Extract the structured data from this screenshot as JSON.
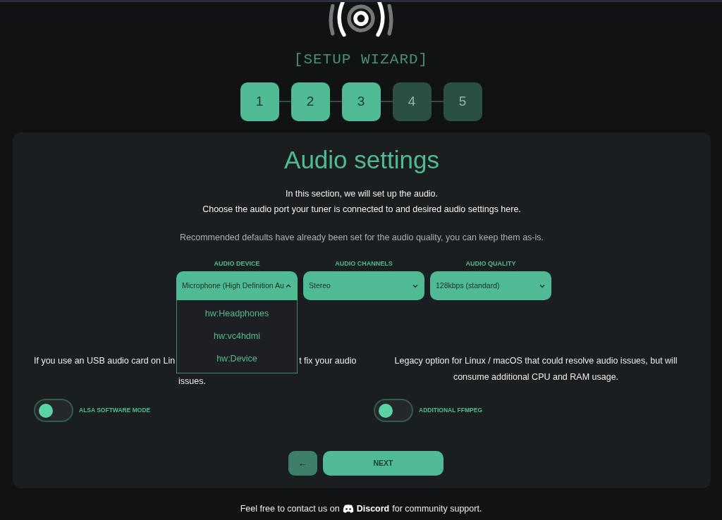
{
  "header": {
    "title": "[SETUP WIZARD]"
  },
  "steps": [
    {
      "label": "1",
      "active": true
    },
    {
      "label": "2",
      "active": true
    },
    {
      "label": "3",
      "active": true
    },
    {
      "label": "4",
      "active": false
    },
    {
      "label": "5",
      "active": false
    }
  ],
  "panel": {
    "title": "Audio settings",
    "intro": [
      "In this section, we will set up the audio.",
      "Choose the audio port your tuner is connected to and desired audio settings here."
    ],
    "note": "Recommended defaults have already been set for the audio quality, you can keep them as-is."
  },
  "selects": [
    {
      "label": "AUDIO DEVICE",
      "value": "Microphone (High Definition Au",
      "expanded": true,
      "options": [
        "hw:Headphones",
        "hw:vc4hdmi",
        "hw:Device"
      ]
    },
    {
      "label": "AUDIO CHANNELS",
      "value": "Stereo",
      "expanded": false
    },
    {
      "label": "AUDIO QUALITY",
      "value": "128kbps (standard)",
      "expanded": false
    }
  ],
  "options": [
    {
      "description_parts": [
        "If you use an USB audio card on Lin",
        "t fix your audio",
        "issues."
      ],
      "toggle_label": "ALSA SOFTWARE MODE",
      "on": false
    },
    {
      "description": "Legacy option for Linux / macOS that could resolve audio issues, but will consume additional CPU and RAM usage.",
      "toggle_label": "ADDITIONAL FFMPEG",
      "on": false
    }
  ],
  "buttons": {
    "back": "←",
    "next": "NEXT"
  },
  "footer": {
    "before": "Feel free to contact us on",
    "link": "Discord",
    "after": "for community support."
  }
}
